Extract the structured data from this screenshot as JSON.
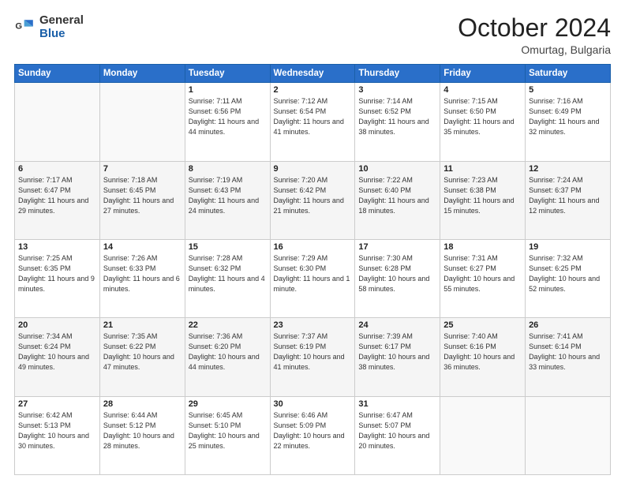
{
  "header": {
    "logo_general": "General",
    "logo_blue": "Blue",
    "month_title": "October 2024",
    "subtitle": "Omurtag, Bulgaria"
  },
  "weekdays": [
    "Sunday",
    "Monday",
    "Tuesday",
    "Wednesday",
    "Thursday",
    "Friday",
    "Saturday"
  ],
  "weeks": [
    [
      {
        "day": "",
        "info": ""
      },
      {
        "day": "",
        "info": ""
      },
      {
        "day": "1",
        "info": "Sunrise: 7:11 AM\nSunset: 6:56 PM\nDaylight: 11 hours and 44 minutes."
      },
      {
        "day": "2",
        "info": "Sunrise: 7:12 AM\nSunset: 6:54 PM\nDaylight: 11 hours and 41 minutes."
      },
      {
        "day": "3",
        "info": "Sunrise: 7:14 AM\nSunset: 6:52 PM\nDaylight: 11 hours and 38 minutes."
      },
      {
        "day": "4",
        "info": "Sunrise: 7:15 AM\nSunset: 6:50 PM\nDaylight: 11 hours and 35 minutes."
      },
      {
        "day": "5",
        "info": "Sunrise: 7:16 AM\nSunset: 6:49 PM\nDaylight: 11 hours and 32 minutes."
      }
    ],
    [
      {
        "day": "6",
        "info": "Sunrise: 7:17 AM\nSunset: 6:47 PM\nDaylight: 11 hours and 29 minutes."
      },
      {
        "day": "7",
        "info": "Sunrise: 7:18 AM\nSunset: 6:45 PM\nDaylight: 11 hours and 27 minutes."
      },
      {
        "day": "8",
        "info": "Sunrise: 7:19 AM\nSunset: 6:43 PM\nDaylight: 11 hours and 24 minutes."
      },
      {
        "day": "9",
        "info": "Sunrise: 7:20 AM\nSunset: 6:42 PM\nDaylight: 11 hours and 21 minutes."
      },
      {
        "day": "10",
        "info": "Sunrise: 7:22 AM\nSunset: 6:40 PM\nDaylight: 11 hours and 18 minutes."
      },
      {
        "day": "11",
        "info": "Sunrise: 7:23 AM\nSunset: 6:38 PM\nDaylight: 11 hours and 15 minutes."
      },
      {
        "day": "12",
        "info": "Sunrise: 7:24 AM\nSunset: 6:37 PM\nDaylight: 11 hours and 12 minutes."
      }
    ],
    [
      {
        "day": "13",
        "info": "Sunrise: 7:25 AM\nSunset: 6:35 PM\nDaylight: 11 hours and 9 minutes."
      },
      {
        "day": "14",
        "info": "Sunrise: 7:26 AM\nSunset: 6:33 PM\nDaylight: 11 hours and 6 minutes."
      },
      {
        "day": "15",
        "info": "Sunrise: 7:28 AM\nSunset: 6:32 PM\nDaylight: 11 hours and 4 minutes."
      },
      {
        "day": "16",
        "info": "Sunrise: 7:29 AM\nSunset: 6:30 PM\nDaylight: 11 hours and 1 minute."
      },
      {
        "day": "17",
        "info": "Sunrise: 7:30 AM\nSunset: 6:28 PM\nDaylight: 10 hours and 58 minutes."
      },
      {
        "day": "18",
        "info": "Sunrise: 7:31 AM\nSunset: 6:27 PM\nDaylight: 10 hours and 55 minutes."
      },
      {
        "day": "19",
        "info": "Sunrise: 7:32 AM\nSunset: 6:25 PM\nDaylight: 10 hours and 52 minutes."
      }
    ],
    [
      {
        "day": "20",
        "info": "Sunrise: 7:34 AM\nSunset: 6:24 PM\nDaylight: 10 hours and 49 minutes."
      },
      {
        "day": "21",
        "info": "Sunrise: 7:35 AM\nSunset: 6:22 PM\nDaylight: 10 hours and 47 minutes."
      },
      {
        "day": "22",
        "info": "Sunrise: 7:36 AM\nSunset: 6:20 PM\nDaylight: 10 hours and 44 minutes."
      },
      {
        "day": "23",
        "info": "Sunrise: 7:37 AM\nSunset: 6:19 PM\nDaylight: 10 hours and 41 minutes."
      },
      {
        "day": "24",
        "info": "Sunrise: 7:39 AM\nSunset: 6:17 PM\nDaylight: 10 hours and 38 minutes."
      },
      {
        "day": "25",
        "info": "Sunrise: 7:40 AM\nSunset: 6:16 PM\nDaylight: 10 hours and 36 minutes."
      },
      {
        "day": "26",
        "info": "Sunrise: 7:41 AM\nSunset: 6:14 PM\nDaylight: 10 hours and 33 minutes."
      }
    ],
    [
      {
        "day": "27",
        "info": "Sunrise: 6:42 AM\nSunset: 5:13 PM\nDaylight: 10 hours and 30 minutes."
      },
      {
        "day": "28",
        "info": "Sunrise: 6:44 AM\nSunset: 5:12 PM\nDaylight: 10 hours and 28 minutes."
      },
      {
        "day": "29",
        "info": "Sunrise: 6:45 AM\nSunset: 5:10 PM\nDaylight: 10 hours and 25 minutes."
      },
      {
        "day": "30",
        "info": "Sunrise: 6:46 AM\nSunset: 5:09 PM\nDaylight: 10 hours and 22 minutes."
      },
      {
        "day": "31",
        "info": "Sunrise: 6:47 AM\nSunset: 5:07 PM\nDaylight: 10 hours and 20 minutes."
      },
      {
        "day": "",
        "info": ""
      },
      {
        "day": "",
        "info": ""
      }
    ]
  ]
}
